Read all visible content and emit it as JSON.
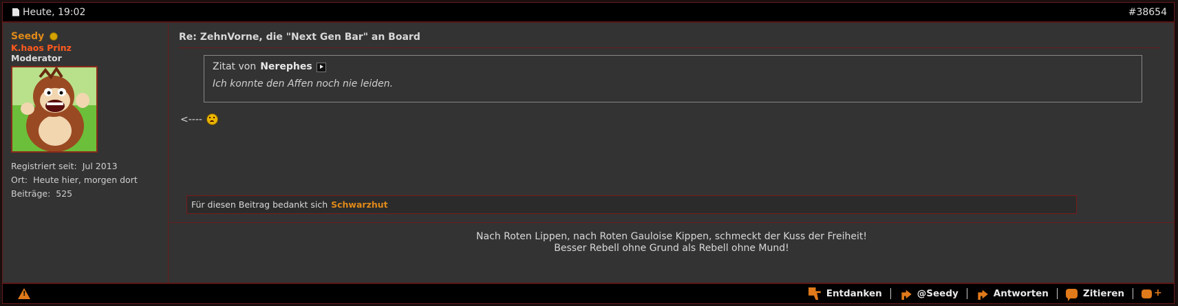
{
  "header": {
    "date": "Heute, 19:02",
    "post_number": "#38654"
  },
  "user": {
    "name": "Seedy",
    "rank": "K.haos Prinz",
    "title": "Moderator",
    "registered_label": "Registriert seit:",
    "registered_value": "Jul 2013",
    "location_label": "Ort:",
    "location_value": "Heute hier, morgen dort",
    "posts_label": "Beiträge:",
    "posts_value": "525"
  },
  "post": {
    "title": "Re: ZehnVorne, die \"Next Gen Bar\" an Board",
    "quote_prefix": "Zitat von",
    "quote_author": "Nerephes",
    "quote_text": "Ich konnte den Affen noch nie leiden.",
    "message": "<----"
  },
  "thanks": {
    "text": "Für diesen Beitrag bedankt sich",
    "user": "Schwarzhut"
  },
  "signature": {
    "line1": "Nach Roten Lippen, nach Roten Gauloise Kippen, schmeckt der Kuss der Freiheit!",
    "line2": "Besser Rebell ohne Grund als Rebell ohne Mund!"
  },
  "footer": {
    "unthank": "Entdanken",
    "mention": "@Seedy",
    "reply": "Antworten",
    "quote": "Zitieren"
  },
  "colors": {
    "accent": "#e08a19",
    "border": "#6b1a1a",
    "background": "#333333"
  }
}
